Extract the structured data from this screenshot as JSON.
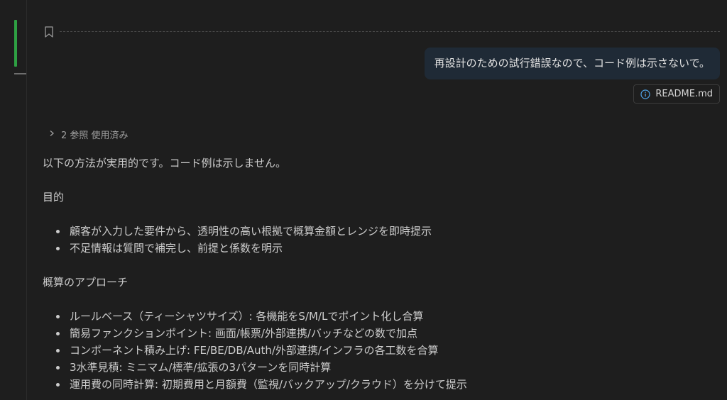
{
  "chat": {
    "user_message": "再設計のための試行錯誤なので、コード例は示さないで。",
    "attachment": {
      "icon": "info-icon",
      "label": "README.md"
    },
    "references": {
      "icon": "chevron-right-icon",
      "label": "2 参照 使用済み"
    },
    "response": {
      "intro": "以下の方法が実用的です。コード例は示しません。",
      "sections": [
        {
          "heading": "目的",
          "items": [
            "顧客が入力した要件から、透明性の高い根拠で概算金額とレンジを即時提示",
            "不足情報は質問で補完し、前提と係数を明示"
          ]
        },
        {
          "heading": "概算のアプローチ",
          "items": [
            "ルールベース（ティーシャツサイズ）: 各機能をS/M/Lでポイント化し合算",
            "簡易ファンクションポイント: 画面/帳票/外部連携/バッチなどの数で加点",
            "コンポーネント積み上げ: FE/BE/DB/Auth/外部連携/インフラの各工数を合算",
            "3水準見積: ミニマム/標準/拡張の3パターンを同時計算",
            "運用費の同時計算: 初期費用と月額費（監視/バックアップ/クラウド）を分けて提示"
          ]
        }
      ]
    }
  },
  "colors": {
    "background": "#1e1e1e",
    "bubble": "#1f2a36",
    "accent_green": "#2ea043"
  }
}
